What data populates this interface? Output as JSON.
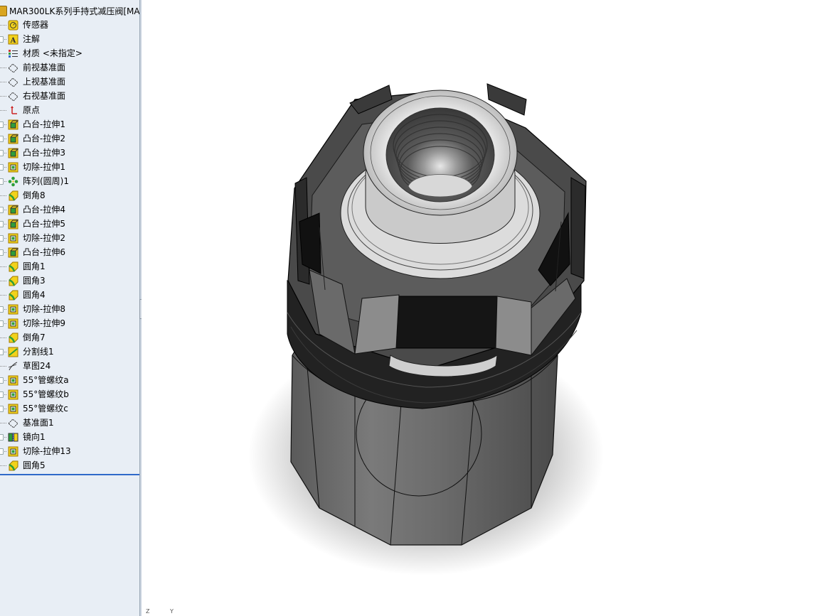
{
  "feature_tree": {
    "title": "MAR300LK系列手持式减压阀[MA",
    "items": [
      {
        "label": "传感器",
        "icon": "sensor-icon",
        "expandable": false
      },
      {
        "label": "注解",
        "icon": "annotation-icon",
        "expandable": true
      },
      {
        "label": "材质 <未指定>",
        "icon": "material-icon",
        "expandable": false
      },
      {
        "label": "前视基准面",
        "icon": "plane-icon",
        "expandable": false
      },
      {
        "label": "上视基准面",
        "icon": "plane-icon",
        "expandable": false
      },
      {
        "label": "右视基准面",
        "icon": "plane-icon",
        "expandable": false
      },
      {
        "label": "原点",
        "icon": "origin-icon",
        "expandable": false
      },
      {
        "label": "凸台-拉伸1",
        "icon": "boss-extrude-icon",
        "expandable": true
      },
      {
        "label": "凸台-拉伸2",
        "icon": "boss-extrude-icon",
        "expandable": true
      },
      {
        "label": "凸台-拉伸3",
        "icon": "boss-extrude-icon",
        "expandable": true
      },
      {
        "label": "切除-拉伸1",
        "icon": "cut-extrude-icon",
        "expandable": true
      },
      {
        "label": "阵列(圆周)1",
        "icon": "circular-pattern-icon",
        "expandable": true
      },
      {
        "label": "倒角8",
        "icon": "chamfer-icon",
        "expandable": false
      },
      {
        "label": "凸台-拉伸4",
        "icon": "boss-extrude-icon",
        "expandable": true
      },
      {
        "label": "凸台-拉伸5",
        "icon": "boss-extrude-icon",
        "expandable": true
      },
      {
        "label": "切除-拉伸2",
        "icon": "cut-extrude-icon",
        "expandable": true
      },
      {
        "label": "凸台-拉伸6",
        "icon": "boss-extrude-icon",
        "expandable": true
      },
      {
        "label": "圆角1",
        "icon": "fillet-icon",
        "expandable": false
      },
      {
        "label": "圆角3",
        "icon": "fillet-icon",
        "expandable": false
      },
      {
        "label": "圆角4",
        "icon": "fillet-icon",
        "expandable": false
      },
      {
        "label": "切除-拉伸8",
        "icon": "cut-extrude-icon",
        "expandable": true
      },
      {
        "label": "切除-拉伸9",
        "icon": "cut-extrude-icon",
        "expandable": true
      },
      {
        "label": "倒角7",
        "icon": "chamfer-icon",
        "expandable": false
      },
      {
        "label": "分割线1",
        "icon": "split-line-icon",
        "expandable": true
      },
      {
        "label": "草图24",
        "icon": "sketch-icon",
        "expandable": false
      },
      {
        "label": "55°管螺纹a",
        "icon": "cut-extrude-icon",
        "expandable": true
      },
      {
        "label": "55°管螺纹b",
        "icon": "cut-extrude-icon",
        "expandable": true
      },
      {
        "label": "55°管螺纹c",
        "icon": "cut-extrude-icon",
        "expandable": true
      },
      {
        "label": "基准面1",
        "icon": "plane-icon",
        "expandable": false
      },
      {
        "label": "镜向1",
        "icon": "mirror-icon",
        "expandable": true
      },
      {
        "label": "切除-拉伸13",
        "icon": "cut-extrude-icon",
        "expandable": true
      },
      {
        "label": "圆角5",
        "icon": "fillet-icon",
        "expandable": false
      }
    ]
  },
  "triad": {
    "z_label": "Z",
    "y_label": "Y"
  },
  "colors": {
    "panel_bg": "#e8eef5",
    "rollback_bar": "#2f69c9",
    "icon_yellow": "#f2d21c",
    "icon_green": "#2e9e3a",
    "model_dark": "#2a2a2a",
    "model_mid": "#6e6e6e",
    "model_light": "#d8d8d8"
  }
}
